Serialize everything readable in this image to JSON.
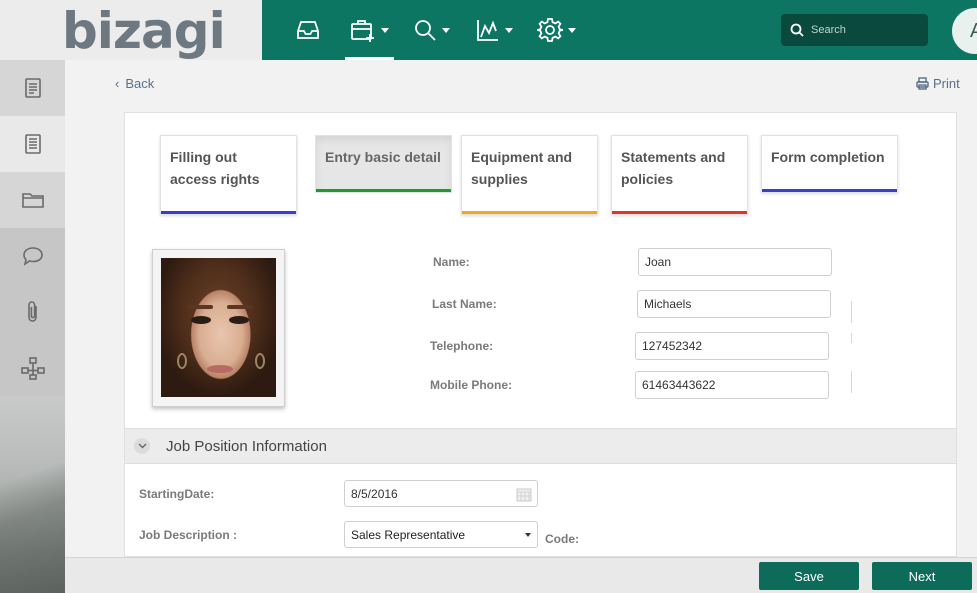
{
  "app": {
    "logo_text": "bizagi"
  },
  "topbar": {
    "items": [
      {
        "icon": "inbox-icon"
      },
      {
        "icon": "new-case-icon"
      },
      {
        "icon": "search-icon"
      },
      {
        "icon": "chart-icon"
      },
      {
        "icon": "gear-icon"
      }
    ],
    "search_placeholder": "Search",
    "avatar_initial": "A"
  },
  "sidebar": {
    "items": [
      {
        "icon": "document-icon"
      },
      {
        "icon": "document-list-icon"
      },
      {
        "icon": "folder-icon"
      },
      {
        "icon": "comment-icon"
      },
      {
        "icon": "attachment-icon"
      },
      {
        "icon": "process-icon"
      }
    ]
  },
  "nav": {
    "back_label": "Back",
    "print_label": "Print"
  },
  "steps": [
    {
      "label": "Filling out access rights",
      "color": "#3a3fc4",
      "state": "done"
    },
    {
      "label": "Entry basic detail",
      "color": "#1e9a2e",
      "state": "current"
    },
    {
      "label": "Equipment and supplies",
      "color": "#f0a81c",
      "state": "done"
    },
    {
      "label": "Statements and policies",
      "color": "#d63a2f",
      "state": "done"
    },
    {
      "label": "Form completion",
      "color": "#3a3fc4",
      "state": "pending"
    }
  ],
  "personal": {
    "name_label": "Name:",
    "name_value": "Joan",
    "last_name_label": "Last Name:",
    "last_name_value": "Michaels",
    "telephone_label": "Telephone:",
    "telephone_value": "127452342",
    "mobile_label": "Mobile Phone:",
    "mobile_value": "61463443622"
  },
  "job_section": {
    "title": "Job Position Information",
    "starting_date_label": "StartingDate:",
    "starting_date_value": "8/5/2016",
    "job_description_label": "Job Description :",
    "job_description_value": "Sales Representative",
    "code_label": "Code:"
  },
  "footer": {
    "save_label": "Save",
    "next_label": "Next"
  },
  "colors": {
    "brand_green": "#0d7663",
    "button_green": "#0d6b59"
  }
}
